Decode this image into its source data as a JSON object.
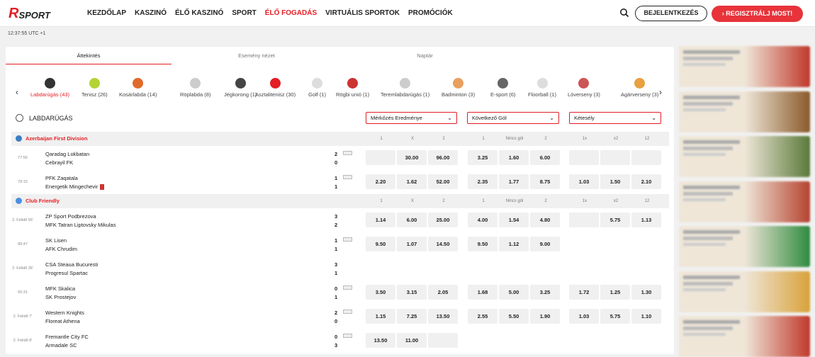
{
  "header": {
    "logo_r": "R",
    "logo_sport": "SPORT",
    "nav": [
      "KEZDŐLAP",
      "KASZINÓ",
      "ÉLŐ KASZINÓ",
      "SPORT",
      "ÉLŐ FOGADÁS",
      "VIRTUÁLIS SPORTOK",
      "PROMÓCIÓK"
    ],
    "active_nav": "ÉLŐ FOGADÁS",
    "login_label": "BEJELENTKEZÉS",
    "register_label": "› REGISZTRÁLJ MOST!",
    "accent": "#e31e24"
  },
  "clock": "12:37:55 UTC +1",
  "tabs": [
    "Áttekintés",
    "Esemény nézet",
    "Naptár"
  ],
  "active_tab": "Áttekintés",
  "sports": [
    {
      "label": "Labdarúgás (43)",
      "icon": "soccer-ball-icon",
      "color": "#333"
    },
    {
      "label": "Tenisz (26)",
      "icon": "tennis-ball-icon",
      "color": "#b5d334"
    },
    {
      "label": "Kosárlabda (14)",
      "icon": "basketball-icon",
      "color": "#e06a2b"
    },
    {
      "label": "Röplabda (8)",
      "icon": "volleyball-icon",
      "color": "#ccc"
    },
    {
      "label": "Jégkorong (1)",
      "icon": "hockey-puck-icon",
      "color": "#444"
    },
    {
      "label": "Asztalitenisz (30)",
      "icon": "table-tennis-icon",
      "color": "#e31e24"
    },
    {
      "label": "Golf (1)",
      "icon": "golf-ball-icon",
      "color": "#ddd"
    },
    {
      "label": "Rögbi unió (1)",
      "icon": "rugby-ball-icon",
      "color": "#c33"
    },
    {
      "label": "Teremlabdarúgás (1)",
      "icon": "futsal-ball-icon",
      "color": "#ccc"
    },
    {
      "label": "Badminton (3)",
      "icon": "shuttlecock-icon",
      "color": "#e8a060"
    },
    {
      "label": "E-sport (6)",
      "icon": "gamepad-icon",
      "color": "#666"
    },
    {
      "label": "Floorball (1)",
      "icon": "floorball-icon",
      "color": "#ddd"
    },
    {
      "label": "Lóverseny (3)",
      "icon": "horse-racing-icon",
      "color": "#c55"
    },
    {
      "label": "Agárverseny (3)",
      "icon": "greyhound-icon",
      "color": "#e8a040"
    }
  ],
  "section_title": "LABDARÚGÁS",
  "markets": [
    "Mérkőzés Eredménye",
    "Következő Gól",
    "Kétesély"
  ],
  "market_cols": [
    [
      "1",
      "X",
      "2"
    ],
    [
      "1",
      "Nincs gól",
      "2"
    ],
    [
      "1x",
      "x2",
      "12"
    ]
  ],
  "leagues": [
    {
      "name": "Azerbaijan First Division",
      "flag_color": "#3a7fc4",
      "matches": [
        {
          "time": "77:56",
          "team1": "Qaradag Lokbatan",
          "team2": "Cebrayil FK",
          "score1": "2",
          "score2": "0",
          "stats": true,
          "red": false,
          "odds": [
            "",
            "30.00",
            "96.00",
            "3.25",
            "1.60",
            "6.00",
            "",
            "",
            ""
          ]
        },
        {
          "time": "79:15",
          "team1": "PFK Zaqatala",
          "team2": "Energetik Mingechevir",
          "score1": "1",
          "score2": "1",
          "stats": true,
          "red": true,
          "odds": [
            "2.20",
            "1.62",
            "52.00",
            "2.35",
            "1.77",
            "8.75",
            "1.03",
            "1.50",
            "2.10"
          ]
        }
      ]
    },
    {
      "name": "Club Friendly",
      "flag_color": "#4a8fe0",
      "matches": [
        {
          "time": "2. Félidő 56'",
          "team1": "ZP Sport Podbrezova",
          "team2": "MFK Tatran Liptovsky Mikulas",
          "score1": "3",
          "score2": "2",
          "stats": false,
          "red": false,
          "odds": [
            "1.14",
            "6.00",
            "25.00",
            "4.00",
            "1.54",
            "4.80",
            "",
            "5.75",
            "1.13"
          ]
        },
        {
          "time": "89:47",
          "team1": "SK Lisen",
          "team2": "AFK Chrudim",
          "score1": "1",
          "score2": "1",
          "stats": true,
          "red": false,
          "odds": [
            "9.50",
            "1.07",
            "14.50",
            "9.50",
            "1.12",
            "9.00",
            "-",
            "-",
            "-"
          ]
        },
        {
          "time": "2. Félidő 36'",
          "team1": "CSA Steaua Bucuresti",
          "team2": "Progresul Spartac",
          "score1": "3",
          "score2": "1",
          "stats": false,
          "red": false,
          "odds": [
            "-",
            "-",
            "-",
            "-",
            "-",
            "-",
            "-",
            "-",
            "-"
          ]
        },
        {
          "time": "50:31",
          "team1": "MFK Skalica",
          "team2": "SK Prostejov",
          "score1": "0",
          "score2": "1",
          "stats": true,
          "red": false,
          "odds": [
            "3.50",
            "3.15",
            "2.05",
            "1.68",
            "5.00",
            "3.25",
            "1.72",
            "1.25",
            "1.30"
          ]
        },
        {
          "time": "2. Félidő 7'",
          "team1": "Western Knights",
          "team2": "Floreat Athena",
          "score1": "2",
          "score2": "0",
          "stats": true,
          "red": false,
          "odds": [
            "1.15",
            "7.25",
            "13.50",
            "2.55",
            "5.50",
            "1.90",
            "1.03",
            "5.75",
            "1.10"
          ]
        },
        {
          "time": "2. Félidő 8'",
          "team1": "Fremantle City FC",
          "team2": "Armadale SC",
          "score1": "0",
          "score2": "3",
          "stats": true,
          "red": false,
          "odds": [
            "13.50",
            "11.00",
            "",
            "-",
            "-",
            "-",
            "-",
            "-",
            "-"
          ]
        }
      ]
    }
  ],
  "promos": [
    {
      "colors": [
        "#efe6d8",
        "#c0392b"
      ],
      "text": "blurred promo"
    },
    {
      "colors": [
        "#efe6d8",
        "#8a5a2b"
      ],
      "text": "blurred promo"
    },
    {
      "colors": [
        "#efe6d8",
        "#5a7a3a"
      ],
      "text": "blurred promo"
    },
    {
      "colors": [
        "#efe6d8",
        "#b5432f"
      ],
      "text": "blurred promo"
    },
    {
      "colors": [
        "#efe6d8",
        "#2e8b3e"
      ],
      "text": "blurred promo"
    },
    {
      "colors": [
        "#efe6d8",
        "#d9a23a"
      ],
      "text": "blurred promo"
    },
    {
      "colors": [
        "#efe6d8",
        "#c0392b"
      ],
      "text": "blurred promo"
    }
  ]
}
